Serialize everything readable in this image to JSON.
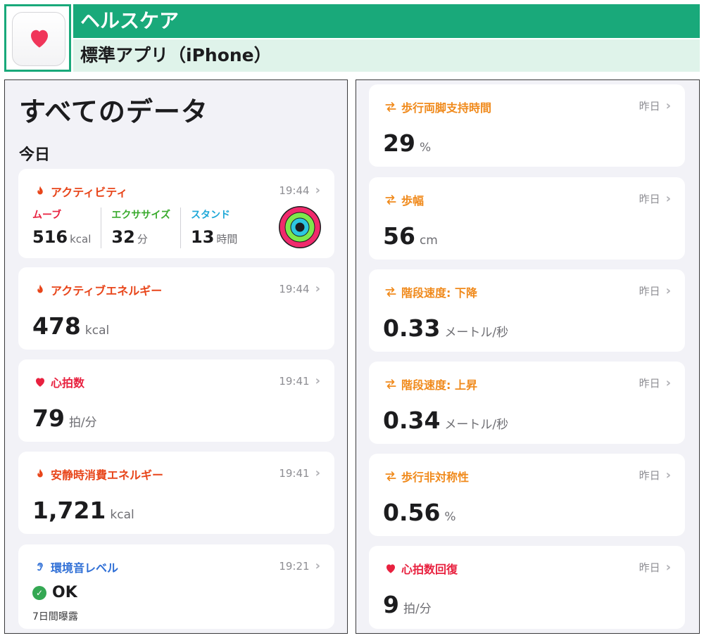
{
  "header": {
    "title": "ヘルスケア",
    "subtitle": "標準アプリ（iPhone）",
    "icon": "heart-icon",
    "accent": "#19a97a"
  },
  "left": {
    "title": "すべてのデータ",
    "section": "今日",
    "activity": {
      "title": "アクティビティ",
      "time": "19:44",
      "move_label": "ムーブ",
      "move_value": "516",
      "move_unit": "kcal",
      "exercise_label": "エクササイズ",
      "exercise_value": "32",
      "exercise_unit": "分",
      "stand_label": "スタンド",
      "stand_value": "13",
      "stand_unit": "時間"
    },
    "cards": [
      {
        "title": "アクティブエネルギー",
        "time": "19:44",
        "value": "478",
        "unit": "kcal",
        "icon": "flame-icon"
      },
      {
        "title": "心拍数",
        "time": "19:41",
        "value": "79",
        "unit": "拍/分",
        "icon": "heart-icon"
      },
      {
        "title": "安静時消費エネルギー",
        "time": "19:41",
        "value": "1,721",
        "unit": "kcal",
        "icon": "flame-icon"
      }
    ],
    "noise": {
      "title": "環境音レベル",
      "time": "19:21",
      "status": "OK",
      "sub": "7日間曝露",
      "icon": "ear-icon"
    }
  },
  "right": {
    "cards": [
      {
        "title": "歩行両脚支持時間",
        "time": "昨日",
        "value": "29",
        "unit": "%",
        "icon": "walk-arrows-icon"
      },
      {
        "title": "歩幅",
        "time": "昨日",
        "value": "56",
        "unit": "cm",
        "icon": "walk-arrows-icon"
      },
      {
        "title": "階段速度: 下降",
        "time": "昨日",
        "value": "0.33",
        "unit": "メートル/秒",
        "icon": "walk-arrows-icon"
      },
      {
        "title": "階段速度: 上昇",
        "time": "昨日",
        "value": "0.34",
        "unit": "メートル/秒",
        "icon": "walk-arrows-icon"
      },
      {
        "title": "歩行非対称性",
        "time": "昨日",
        "value": "0.56",
        "unit": "%",
        "icon": "walk-arrows-icon"
      },
      {
        "title": "心拍数回復",
        "time": "昨日",
        "value": "9",
        "unit": "拍/分",
        "icon": "heart-icon"
      }
    ]
  }
}
